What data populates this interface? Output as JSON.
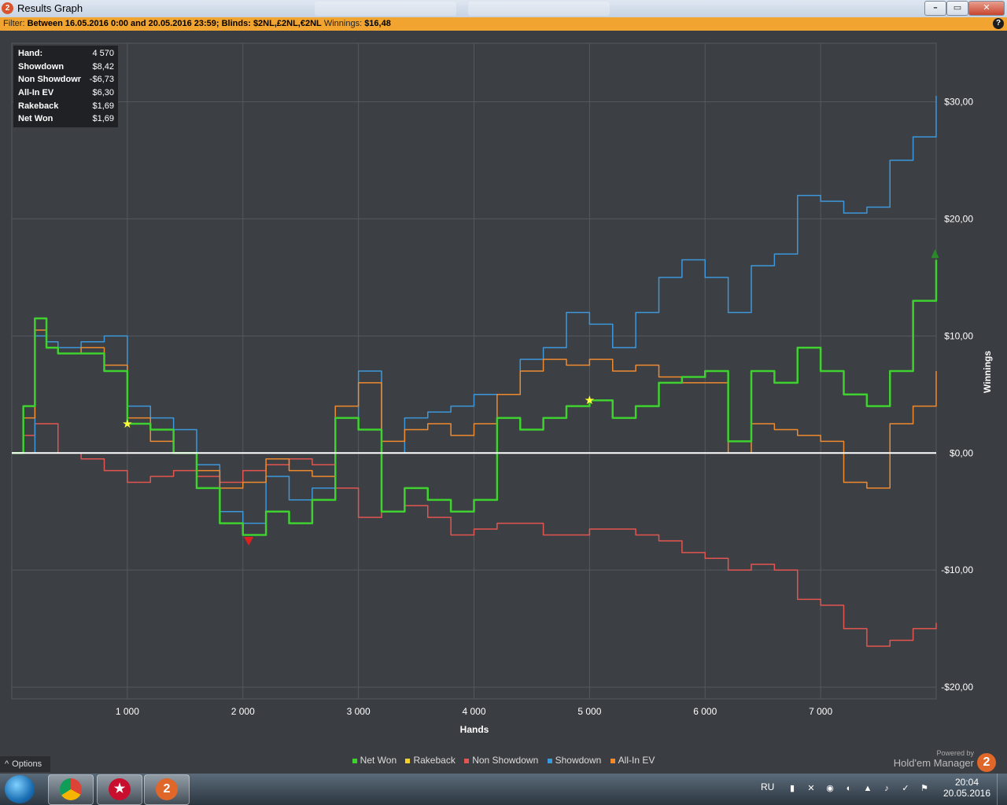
{
  "window": {
    "title": "Results Graph",
    "app_icon": "hm2-icon"
  },
  "filter": {
    "label": "Filter:",
    "text": "Between 16.05.2016 0:00 and 20.05.2016 23:59; Blinds: $2NL,£2NL,€2NL",
    "winnings_label": "Winnings:",
    "winnings_value": "$16,48"
  },
  "info_box": {
    "rows": [
      {
        "key": "Hand:",
        "value": "4 570"
      },
      {
        "key": "Showdown",
        "value": "$8,42"
      },
      {
        "key": "Non Showdown",
        "value": "-$6,73"
      },
      {
        "key": "All-In EV",
        "value": "$6,30"
      },
      {
        "key": "Rakeback",
        "value": "$1,69"
      },
      {
        "key": "Net Won",
        "value": "$1,69"
      }
    ]
  },
  "chart_data": {
    "type": "line",
    "xlabel": "Hands",
    "ylabel": "Winnings",
    "xlim": [
      0,
      8000
    ],
    "ylim": [
      -21,
      35
    ],
    "x_ticks": [
      1000,
      2000,
      3000,
      4000,
      5000,
      6000,
      7000
    ],
    "x_tick_labels": [
      "1 000",
      "2 000",
      "3 000",
      "4 000",
      "5 000",
      "6 000",
      "7 000"
    ],
    "y_ticks": [
      30,
      20,
      10,
      0,
      -10,
      -20
    ],
    "y_tick_labels": [
      "$30,00",
      "$20,00",
      "$10,00",
      "$0,00",
      "-$10,00",
      "-$20,00"
    ],
    "grid": true,
    "legend_position": "bottom",
    "series": [
      {
        "name": "Net Won",
        "color": "#3fd12f",
        "x": [
          0,
          100,
          200,
          300,
          400,
          600,
          800,
          1000,
          1200,
          1400,
          1600,
          1800,
          2000,
          2200,
          2400,
          2600,
          2800,
          3000,
          3200,
          3400,
          3600,
          3800,
          4000,
          4200,
          4400,
          4600,
          4800,
          5000,
          5200,
          5400,
          5600,
          5800,
          6000,
          6200,
          6400,
          6600,
          6800,
          7000,
          7200,
          7400,
          7600,
          7800,
          8000
        ],
        "y": [
          0,
          4,
          11.5,
          9,
          8.5,
          8.5,
          7,
          2.5,
          2,
          0,
          -3,
          -6,
          -7,
          -5,
          -6,
          -4,
          3,
          2,
          -5,
          -3,
          -4,
          -5,
          -4,
          3,
          2,
          3,
          4,
          4.5,
          3,
          4,
          6,
          6.5,
          7,
          1,
          7,
          6,
          9,
          7,
          5,
          4,
          7,
          13,
          16.5
        ]
      },
      {
        "name": "Rakeback",
        "color": "#f4d22a",
        "x": [
          0,
          8000
        ],
        "y": [
          0,
          0
        ]
      },
      {
        "name": "Non Showdown",
        "color": "#e35550",
        "x": [
          0,
          100,
          200,
          400,
          600,
          800,
          1000,
          1200,
          1400,
          1600,
          1800,
          2000,
          2200,
          2400,
          2600,
          2800,
          3000,
          3200,
          3400,
          3600,
          3800,
          4000,
          4200,
          4400,
          4600,
          4800,
          5000,
          5200,
          5400,
          5600,
          5800,
          6000,
          6200,
          6400,
          6600,
          6800,
          7000,
          7200,
          7400,
          7600,
          7800,
          8000
        ],
        "y": [
          0,
          1.5,
          2.5,
          0,
          -0.5,
          -1.5,
          -2.5,
          -2,
          -1.5,
          -2,
          -2.5,
          -1.5,
          -1,
          -0.5,
          -1,
          -3,
          -5.5,
          -5,
          -4.5,
          -5.5,
          -7,
          -6.5,
          -6,
          -6,
          -7,
          -7,
          -6.5,
          -6.5,
          -7,
          -7.5,
          -8.5,
          -9,
          -10,
          -9.5,
          -10,
          -12.5,
          -13,
          -15,
          -16.5,
          -16,
          -15,
          -14.5
        ]
      },
      {
        "name": "Showdown",
        "color": "#3c98db",
        "x": [
          0,
          100,
          200,
          300,
          400,
          600,
          800,
          1000,
          1200,
          1400,
          1600,
          1800,
          2000,
          2200,
          2400,
          2600,
          2800,
          3000,
          3200,
          3400,
          3600,
          3800,
          4000,
          4200,
          4400,
          4600,
          4800,
          5000,
          5200,
          5400,
          5600,
          5800,
          6000,
          6200,
          6400,
          6600,
          6800,
          7000,
          7200,
          7400,
          7600,
          7800,
          8000
        ],
        "y": [
          0,
          0,
          10,
          9.5,
          9,
          9.5,
          10,
          4,
          3,
          2,
          -1,
          -5,
          -6,
          -2,
          -4,
          -3,
          3,
          7,
          0,
          3,
          3.5,
          4,
          5,
          5,
          8,
          9,
          12,
          11,
          9,
          12,
          15,
          16.5,
          15,
          12,
          16,
          17,
          22,
          21.5,
          20.5,
          21,
          25,
          27,
          30.5
        ]
      },
      {
        "name": "All-In EV",
        "color": "#f08a2f",
        "x": [
          0,
          100,
          200,
          300,
          400,
          600,
          800,
          1000,
          1200,
          1400,
          1600,
          1800,
          2000,
          2200,
          2400,
          2600,
          2800,
          3000,
          3200,
          3400,
          3600,
          3800,
          4000,
          4200,
          4400,
          4600,
          4800,
          5000,
          5200,
          5400,
          5600,
          5800,
          6000,
          6200,
          6400,
          6600,
          6800,
          7000,
          7200,
          7400,
          7600,
          7800,
          8000
        ],
        "y": [
          0,
          3,
          10.5,
          9,
          8.5,
          9,
          7.5,
          3,
          1,
          0,
          -1.5,
          -3,
          -2.5,
          -0.5,
          -1.5,
          -2,
          4,
          6,
          1,
          2,
          2.5,
          1.5,
          2.5,
          5,
          7,
          8,
          7.5,
          8,
          7,
          7.5,
          6.5,
          6,
          6,
          0,
          2.5,
          2,
          1.5,
          1,
          -2.5,
          -3,
          2.5,
          4,
          7
        ]
      }
    ],
    "markers": [
      {
        "shape": "star",
        "color": "#ffff3a",
        "x": 1000,
        "y": 2.5
      },
      {
        "shape": "star",
        "color": "#ffff3a",
        "x": 5000,
        "y": 4.5
      },
      {
        "shape": "triangle-down",
        "color": "#e02020",
        "x": 2050,
        "y": -7.5
      },
      {
        "shape": "triangle-up",
        "color": "#2a8a2a",
        "x": 7990,
        "y": 17
      }
    ]
  },
  "legend": [
    {
      "label": "Net Won",
      "color": "#3fd12f"
    },
    {
      "label": "Rakeback",
      "color": "#f4d22a"
    },
    {
      "label": "Non Showdown",
      "color": "#e35550"
    },
    {
      "label": "Showdown",
      "color": "#3c98db"
    },
    {
      "label": "All-In EV",
      "color": "#f08a2f"
    }
  ],
  "options_label": "Options",
  "powered_by": {
    "line1": "Powered by",
    "line2": "Hold'em Manager",
    "logo": "2"
  },
  "taskbar": {
    "apps": [
      {
        "name": "chrome-icon",
        "glyph": ""
      },
      {
        "name": "pokerstars-icon",
        "glyph": "★"
      },
      {
        "name": "hm2-icon",
        "glyph": "2"
      }
    ],
    "lang": "RU",
    "time": "20:04",
    "date": "20.05.2016"
  }
}
